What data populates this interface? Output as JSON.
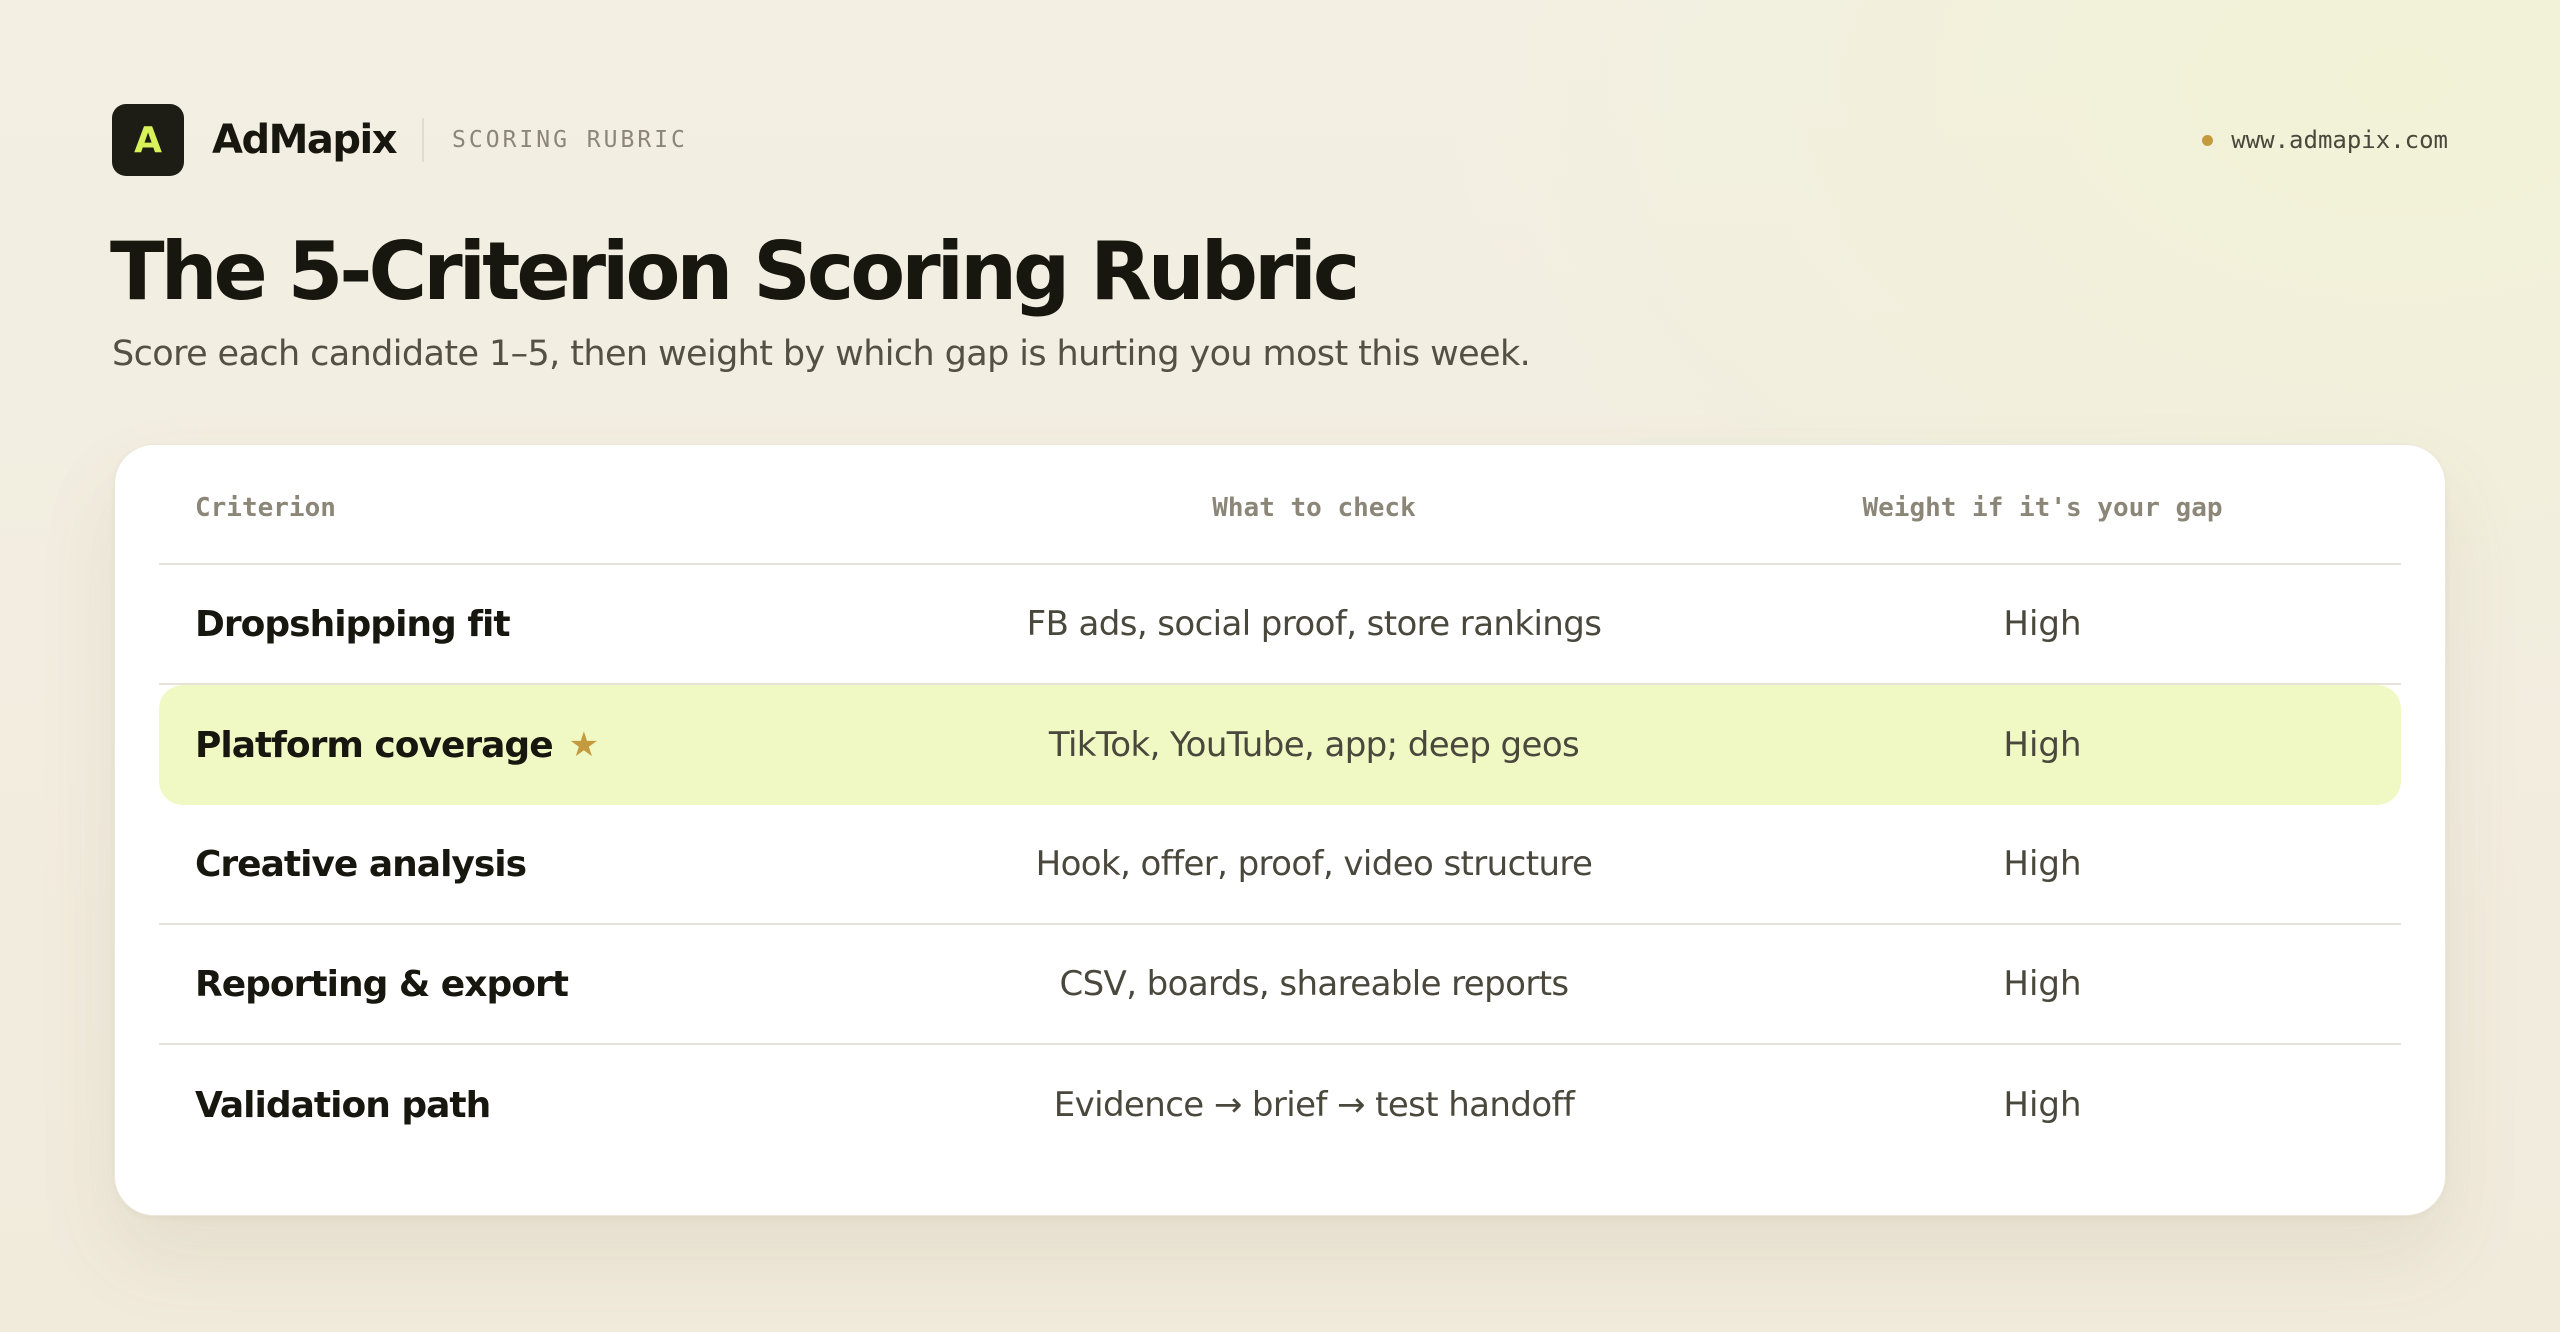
{
  "brand": {
    "logo_letter": "A",
    "name": "AdMapix",
    "section_label": "SCORING RUBRIC",
    "site_url": "www.admapix.com"
  },
  "heading": {
    "title": "The 5-Criterion Scoring Rubric",
    "subtitle": "Score each candidate 1–5, then weight by which gap is hurting you most this week."
  },
  "table": {
    "columns": [
      "Criterion",
      "What to check",
      "Weight if it's your gap"
    ],
    "rows": [
      {
        "criterion": "Dropshipping fit",
        "check": "FB ads, social proof, store rankings",
        "weight": "High",
        "highlighted": false
      },
      {
        "criterion": "Platform coverage",
        "check": "TikTok, YouTube, app; deep geos",
        "weight": "High",
        "highlighted": true,
        "icon": "star-icon"
      },
      {
        "criterion": "Creative analysis",
        "check": "Hook, offer, proof, video structure",
        "weight": "High",
        "highlighted": false
      },
      {
        "criterion": "Reporting & export",
        "check": "CSV, boards, shareable reports",
        "weight": "High",
        "highlighted": false
      },
      {
        "criterion": "Validation path",
        "check": "Evidence → brief → test handoff",
        "weight": "High",
        "highlighted": false
      }
    ]
  },
  "colors": {
    "accent": "#d8f25a",
    "highlight_row": "#f0f9c3",
    "star": "#c49a3f",
    "dot": "#c49a3f"
  }
}
